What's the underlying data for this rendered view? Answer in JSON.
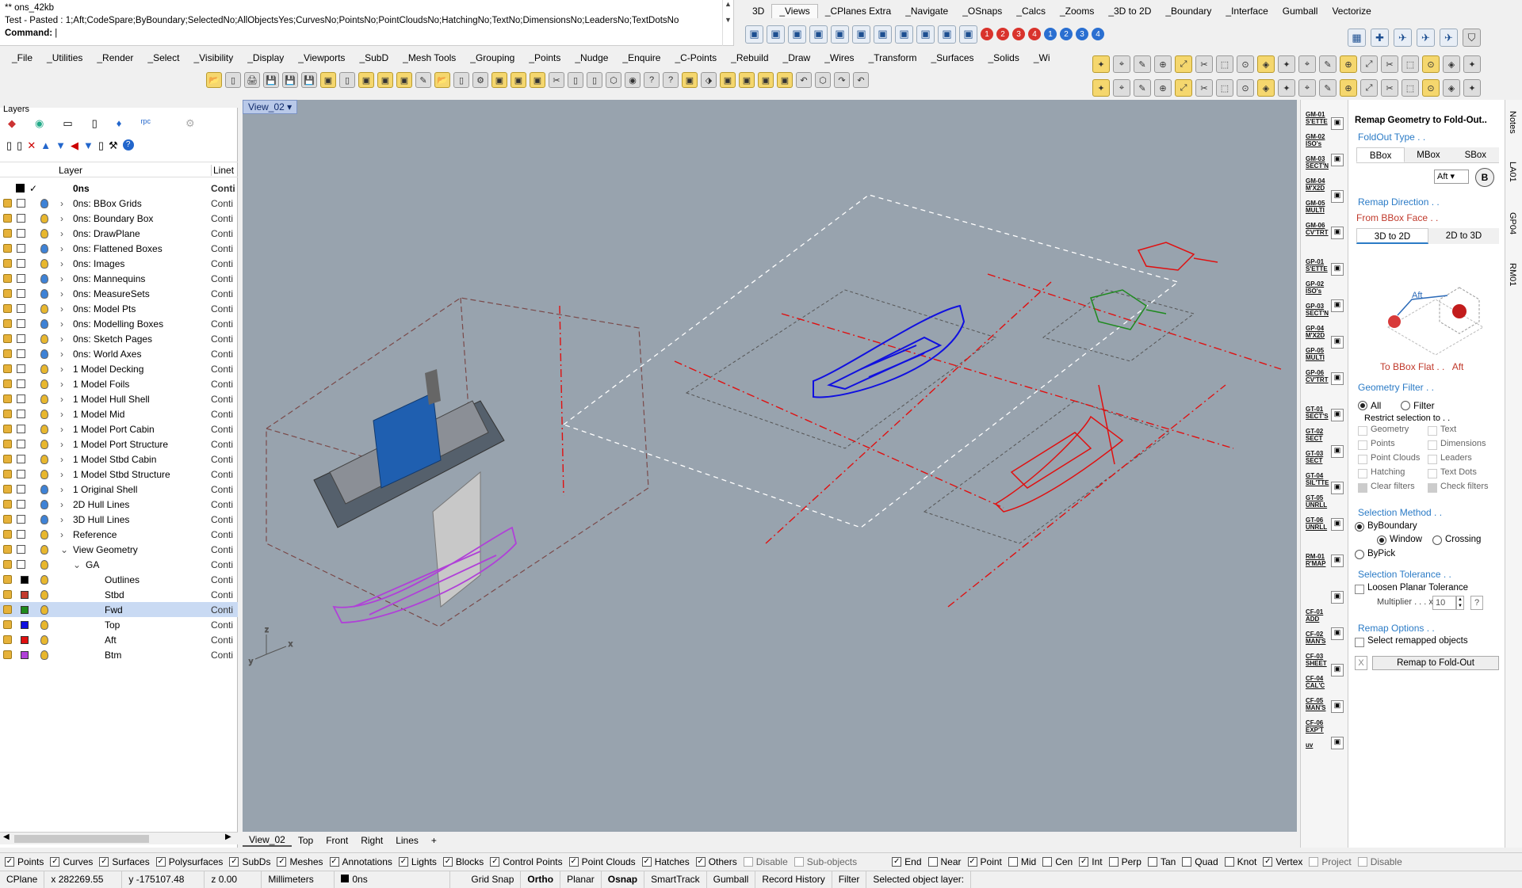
{
  "command": {
    "line1": "** ons_42kb",
    "line2": "Test - Pasted : 1;Aft;CodeSpare;ByBoundary;SelectedNo;AllObjectsYes;CurvesNo;PointsNo;PointCloudsNo;HatchingNo;TextNo;DimensionsNo;LeadersNo;TextDotsNo",
    "prompt": "Command:"
  },
  "tabs_top": [
    "3D",
    "_Views",
    "_CPlanes Extra",
    "_Navigate",
    "_OSnaps",
    "_Calcs",
    "_Zooms",
    "_3D to 2D",
    "_Boundary",
    "_Interface",
    "Gumball",
    "Vectorize"
  ],
  "tabs_top_active": "_Views",
  "tabs_main": [
    "_File",
    "_Utilities",
    "_Render",
    "_Select",
    "_Visibility",
    "_Display",
    "_Viewports",
    "_SubD",
    "_Mesh Tools",
    "_Grouping",
    "_Points",
    "_Nudge",
    "_Enquire",
    "_C-Points",
    "_Rebuild",
    "_Draw",
    "_Wires",
    "_Transform",
    "_Surfaces",
    "_Solids",
    "_Wi"
  ],
  "view_icons": [
    "1",
    "2",
    "3",
    "4",
    "1",
    "2",
    "3",
    "4"
  ],
  "layers": {
    "title": "Layers",
    "col_layer": "Layer",
    "col_linetype": "Linet",
    "rows": [
      {
        "name": "0ns",
        "ltype": "Conti",
        "indent": 0,
        "bulb": "",
        "swatch": "#000000",
        "current": true
      },
      {
        "name": "0ns: BBox Grids",
        "ltype": "Conti",
        "indent": 0,
        "bulb": "#3e82d6",
        "swatch": "#ffffff",
        "exp": ">"
      },
      {
        "name": "0ns: Boundary Box",
        "ltype": "Conti",
        "indent": 0,
        "bulb": "#e8b72e",
        "swatch": "#ffffff",
        "exp": ">"
      },
      {
        "name": "0ns: DrawPlane",
        "ltype": "Conti",
        "indent": 0,
        "bulb": "#e8b72e",
        "swatch": "#ffffff",
        "exp": ">"
      },
      {
        "name": "0ns: Flattened Boxes",
        "ltype": "Conti",
        "indent": 0,
        "bulb": "#3e82d6",
        "swatch": "#ffffff",
        "exp": ">"
      },
      {
        "name": "0ns: Images",
        "ltype": "Conti",
        "indent": 0,
        "bulb": "#e8b72e",
        "swatch": "#ffffff",
        "exp": ">"
      },
      {
        "name": "0ns: Mannequins",
        "ltype": "Conti",
        "indent": 0,
        "bulb": "#3e82d6",
        "swatch": "#ffffff",
        "exp": ">"
      },
      {
        "name": "0ns: MeasureSets",
        "ltype": "Conti",
        "indent": 0,
        "bulb": "#3e82d6",
        "swatch": "#ffffff",
        "exp": ">"
      },
      {
        "name": "0ns: Model Pts",
        "ltype": "Conti",
        "indent": 0,
        "bulb": "#e8b72e",
        "swatch": "#ffffff",
        "exp": ">"
      },
      {
        "name": "0ns: Modelling Boxes",
        "ltype": "Conti",
        "indent": 0,
        "bulb": "#3e82d6",
        "swatch": "#ffffff",
        "exp": ">"
      },
      {
        "name": "0ns: Sketch Pages",
        "ltype": "Conti",
        "indent": 0,
        "bulb": "#e8b72e",
        "swatch": "#ffffff",
        "exp": ">"
      },
      {
        "name": "0ns: World Axes",
        "ltype": "Conti",
        "indent": 0,
        "bulb": "#3e82d6",
        "swatch": "#ffffff",
        "exp": ">"
      },
      {
        "name": "1 Model Decking",
        "ltype": "Conti",
        "indent": 0,
        "bulb": "#e8b72e",
        "swatch": "#ffffff",
        "exp": ">"
      },
      {
        "name": "1 Model Foils",
        "ltype": "Conti",
        "indent": 0,
        "bulb": "#e8b72e",
        "swatch": "#ffffff",
        "exp": ">"
      },
      {
        "name": "1 Model Hull Shell",
        "ltype": "Conti",
        "indent": 0,
        "bulb": "#e8b72e",
        "swatch": "#ffffff",
        "exp": ">"
      },
      {
        "name": "1 Model Mid",
        "ltype": "Conti",
        "indent": 0,
        "bulb": "#e8b72e",
        "swatch": "#ffffff",
        "exp": ">"
      },
      {
        "name": "1 Model Port Cabin",
        "ltype": "Conti",
        "indent": 0,
        "bulb": "#e8b72e",
        "swatch": "#ffffff",
        "exp": ">"
      },
      {
        "name": "1 Model Port Structure",
        "ltype": "Conti",
        "indent": 0,
        "bulb": "#e8b72e",
        "swatch": "#ffffff",
        "exp": ">"
      },
      {
        "name": "1 Model Stbd Cabin",
        "ltype": "Conti",
        "indent": 0,
        "bulb": "#e8b72e",
        "swatch": "#ffffff",
        "exp": ">"
      },
      {
        "name": "1 Model Stbd Structure",
        "ltype": "Conti",
        "indent": 0,
        "bulb": "#e8b72e",
        "swatch": "#ffffff",
        "exp": ">"
      },
      {
        "name": "1 Original Shell",
        "ltype": "Conti",
        "indent": 0,
        "bulb": "#3e82d6",
        "swatch": "#ffffff",
        "exp": ">"
      },
      {
        "name": "2D Hull Lines",
        "ltype": "Conti",
        "indent": 0,
        "bulb": "#3e82d6",
        "swatch": "#ffffff",
        "exp": ">"
      },
      {
        "name": "3D Hull Lines",
        "ltype": "Conti",
        "indent": 0,
        "bulb": "#3e82d6",
        "swatch": "#ffffff",
        "exp": ">"
      },
      {
        "name": "Reference",
        "ltype": "Conti",
        "indent": 0,
        "bulb": "#e8b72e",
        "swatch": "#ffffff",
        "exp": ">"
      },
      {
        "name": "View Geometry",
        "ltype": "Conti",
        "indent": 0,
        "bulb": "#e8b72e",
        "swatch": "#ffffff",
        "exp": "v"
      },
      {
        "name": "GA",
        "ltype": "Conti",
        "indent": 1,
        "bulb": "#e8b72e",
        "swatch": "#ffffff",
        "exp": "v"
      },
      {
        "name": "Outlines",
        "ltype": "Conti",
        "indent": 2,
        "bulb": "#e8b72e",
        "swatch": "#000000"
      },
      {
        "name": "Stbd",
        "ltype": "Conti",
        "indent": 2,
        "bulb": "#e8b72e",
        "swatch": "#c23a2e"
      },
      {
        "name": "Fwd",
        "ltype": "Conti",
        "indent": 2,
        "bulb": "#e8b72e",
        "swatch": "#1e8a1e",
        "selected": true
      },
      {
        "name": "Top",
        "ltype": "Conti",
        "indent": 2,
        "bulb": "#e8b72e",
        "swatch": "#1010e0"
      },
      {
        "name": "Aft",
        "ltype": "Conti",
        "indent": 2,
        "bulb": "#e8b72e",
        "swatch": "#e01010"
      },
      {
        "name": "Btm",
        "ltype": "Conti",
        "indent": 2,
        "bulb": "#e8b72e",
        "swatch": "#b040d8"
      }
    ]
  },
  "viewport": {
    "title": "View_02",
    "axes": {
      "x": "x",
      "y": "y",
      "z": "z"
    }
  },
  "viewport_tabs": [
    "View_02",
    "Top",
    "Front",
    "Right",
    "Lines",
    "+"
  ],
  "sidebar_labels": [
    {
      "t": "GM-01 S'ETTE"
    },
    {
      "t": "GM-02 ISO's"
    },
    {
      "t": "GM-03 SECT'N"
    },
    {
      "t": "GM-04 M'X2D"
    },
    {
      "t": "GM-05 MULTI"
    },
    {
      "t": "GM-06 CV'TRT"
    },
    {
      "t": "GP-01 S'ETTE"
    },
    {
      "t": "GP-02 ISO's"
    },
    {
      "t": "GP-03 SECT'N"
    },
    {
      "t": "GP-04 M'X2D"
    },
    {
      "t": "GP-05 MULTI"
    },
    {
      "t": "GP-06 CV'TRT"
    },
    {
      "t": "GT-01 SECT'S"
    },
    {
      "t": "GT-02 SECT"
    },
    {
      "t": "GT-03 SECT"
    },
    {
      "t": "GT-04 SIL'TTE"
    },
    {
      "t": "GT-05 UNRLL"
    },
    {
      "t": "GT-06 UNRLL"
    },
    {
      "t": "RM-01 R'MAP"
    },
    {
      "t": "CF-01 ADD"
    },
    {
      "t": "CF-02 MAN'S"
    },
    {
      "t": "CF-03 SHEET"
    },
    {
      "t": "CF-04 CAL'C"
    },
    {
      "t": "CF-05 MAN'S"
    },
    {
      "t": "CF-06 EXP'T"
    },
    {
      "t": "uv"
    }
  ],
  "panel": {
    "title": "Remap Geometry to Fold-Out..",
    "foldout_type": "FoldOut Type . .",
    "type_tabs": [
      "BBox",
      "MBox",
      "SBox"
    ],
    "side_value": "Aft",
    "remap_direction": "Remap Direction . .",
    "from_face": "From BBox Face . .",
    "dir_tabs": [
      "3D to 2D",
      "2D to 3D"
    ],
    "diagram_label": "Aft",
    "to_flat": "To BBox Flat . .",
    "to_flat_value": "Aft",
    "geometry_filter": "Geometry Filter . .",
    "all": "All",
    "filter": "Filter",
    "restrict": "Restrict selection to . .",
    "filters_left": [
      "Geometry",
      "Points",
      "Point Clouds",
      "Hatching",
      "Clear filters"
    ],
    "filters_right": [
      "Text",
      "Dimensions",
      "Leaders",
      "Text Dots",
      "Check filters"
    ],
    "selection_method": "Selection Method . .",
    "by_boundary": "ByBoundary",
    "window": "Window",
    "crossing": "Crossing",
    "by_pick": "ByPick",
    "selection_tolerance": "Selection Tolerance . .",
    "loosen": "Loosen Planar Tolerance",
    "multiplier": "Multiplier . . .  x",
    "multiplier_value": "10",
    "help": "?",
    "remap_options": "Remap Options . .",
    "select_remapped": "Select remapped objects",
    "x": "X",
    "remap_button": "Remap to Fold-Out"
  },
  "vertical_tabs": [
    "Notes",
    "LA01",
    "GP04",
    "RM01"
  ],
  "filters": [
    {
      "t": "Points",
      "on": true
    },
    {
      "t": "Curves",
      "on": true
    },
    {
      "t": "Surfaces",
      "on": true
    },
    {
      "t": "Polysurfaces",
      "on": true
    },
    {
      "t": "SubDs",
      "on": true
    },
    {
      "t": "Meshes",
      "on": true
    },
    {
      "t": "Annotations",
      "on": true
    },
    {
      "t": "Lights",
      "on": true
    },
    {
      "t": "Blocks",
      "on": true
    },
    {
      "t": "Control Points",
      "on": true
    },
    {
      "t": "Point Clouds",
      "on": true
    },
    {
      "t": "Hatches",
      "on": true
    },
    {
      "t": "Others",
      "on": true
    },
    {
      "t": "Disable",
      "on": false,
      "dis": true
    },
    {
      "t": "Sub-objects",
      "on": false,
      "dis": true
    }
  ],
  "osnaps": [
    {
      "t": "End",
      "on": true
    },
    {
      "t": "Near",
      "on": false
    },
    {
      "t": "Point",
      "on": true
    },
    {
      "t": "Mid",
      "on": false
    },
    {
      "t": "Cen",
      "on": false
    },
    {
      "t": "Int",
      "on": true
    },
    {
      "t": "Perp",
      "on": false
    },
    {
      "t": "Tan",
      "on": false
    },
    {
      "t": "Quad",
      "on": false
    },
    {
      "t": "Knot",
      "on": false
    },
    {
      "t": "Vertex",
      "on": true
    },
    {
      "t": "Project",
      "on": false,
      "dis": true
    },
    {
      "t": "Disable",
      "on": false,
      "dis": true
    }
  ],
  "status": {
    "cplane": "CPlane",
    "x": "x 282269.55",
    "y": "y -175107.48",
    "z": "z 0.00",
    "units": "Millimeters",
    "layer": "0ns",
    "toggles": [
      "Grid Snap",
      "Ortho",
      "Planar",
      "Osnap",
      "SmartTrack",
      "Gumball",
      "Record History",
      "Filter"
    ],
    "bold": [
      "Ortho",
      "Osnap"
    ],
    "message": "Selected object layer:"
  }
}
